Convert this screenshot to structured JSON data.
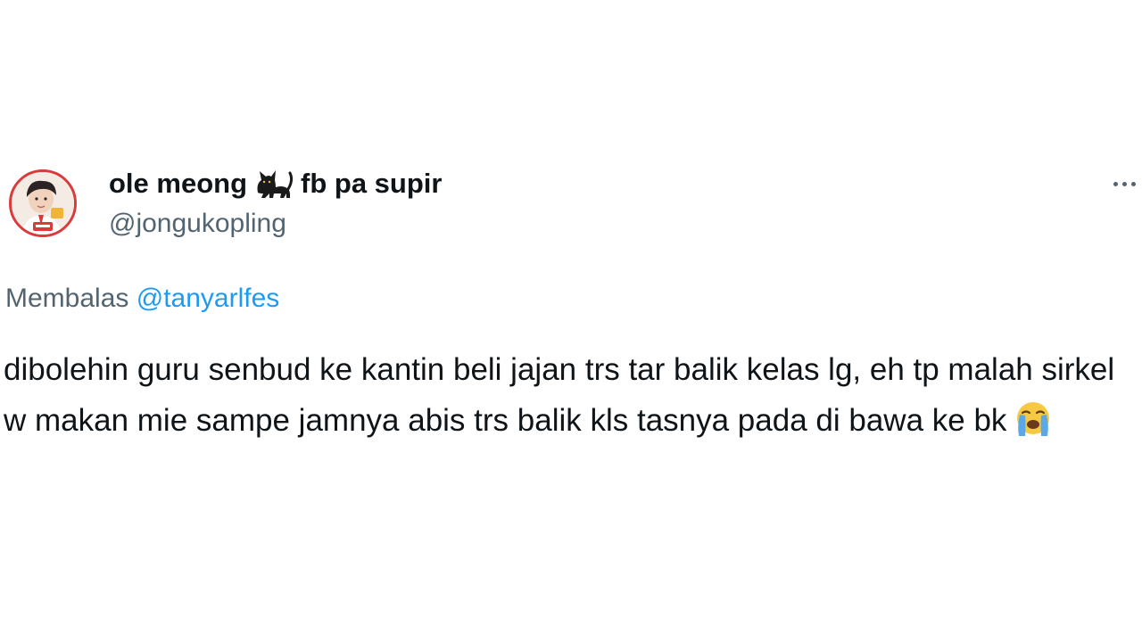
{
  "tweet": {
    "display_name": "ole meong",
    "display_name_suffix": "fb pa supir",
    "name_emoji": "black-cat-icon",
    "handle": "@jongukopling",
    "reply_prefix": "Membalas",
    "reply_to": "@tanyarlfes",
    "text": "dibolehin guru senbud ke kantin beli jajan trs tar balik kelas lg, eh tp malah sirkel w makan mie sampe jamnya abis trs balik kls tasnya pada di bawa ke bk",
    "text_emoji": "loudly-crying-face-icon",
    "more_icon": "more-options-icon"
  },
  "colors": {
    "text": "#0f1419",
    "secondary": "#536471",
    "link": "#1d9bf0",
    "avatar_ring": "#d93a3a"
  }
}
